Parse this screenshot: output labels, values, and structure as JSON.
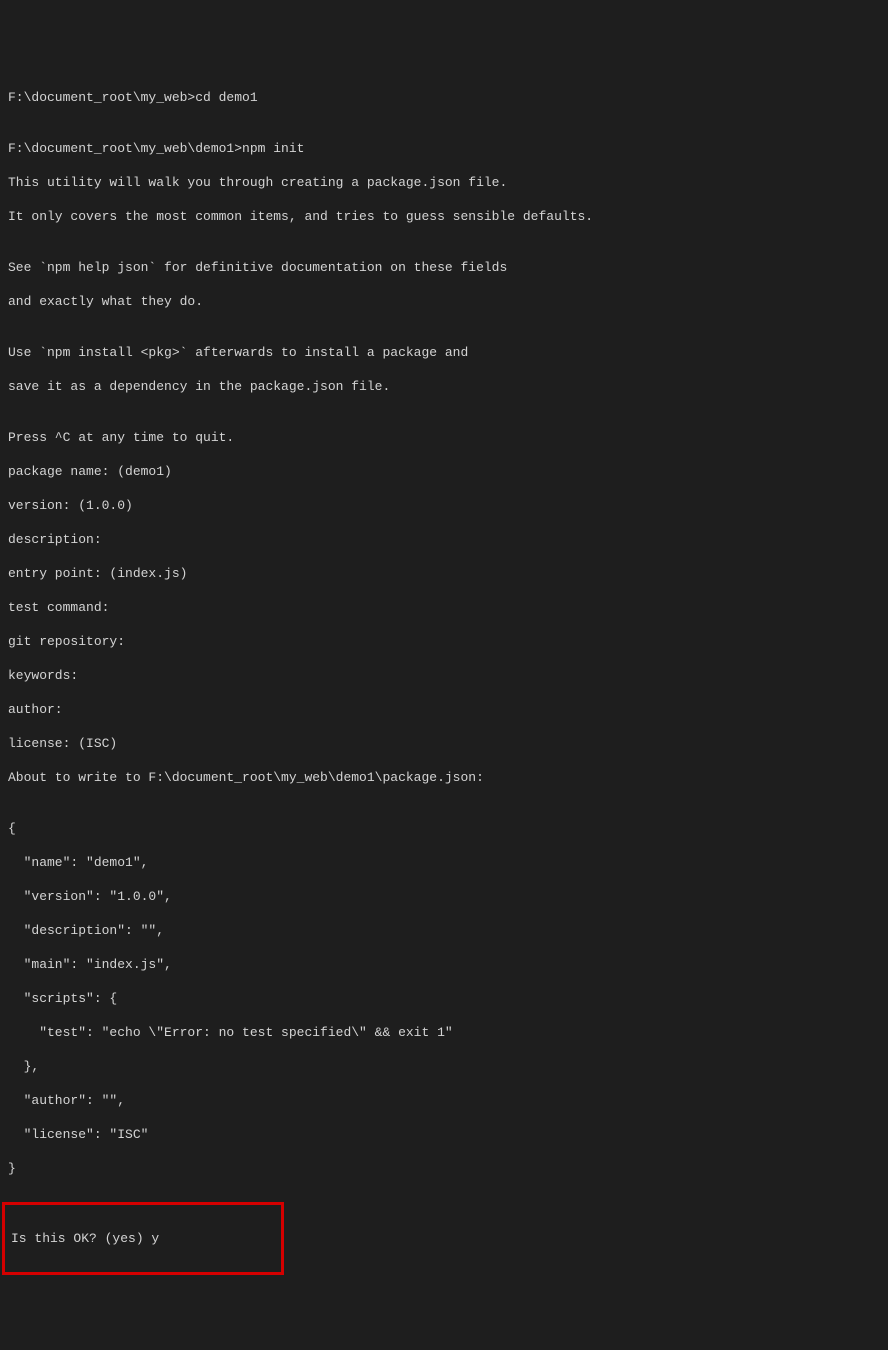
{
  "lines": {
    "l1": "F:\\document_root\\my_web>cd demo1",
    "l2": "",
    "l3": "F:\\document_root\\my_web\\demo1>npm init",
    "l4": "This utility will walk you through creating a package.json file.",
    "l5": "It only covers the most common items, and tries to guess sensible defaults.",
    "l6": "",
    "l7": "See `npm help json` for definitive documentation on these fields",
    "l8": "and exactly what they do.",
    "l9": "",
    "l10": "Use `npm install <pkg>` afterwards to install a package and",
    "l11": "save it as a dependency in the package.json file.",
    "l12": "",
    "l13": "Press ^C at any time to quit.",
    "l14": "package name: (demo1)",
    "l15": "version: (1.0.0)",
    "l16": "description:",
    "l17": "entry point: (index.js)",
    "l18": "test command:",
    "l19": "git repository:",
    "l20": "keywords:",
    "l21": "author:",
    "l22": "license: (ISC)",
    "l23": "About to write to F:\\document_root\\my_web\\demo1\\package.json:",
    "l24": "",
    "l25": "{",
    "l26": "  \"name\": \"demo1\",",
    "l27": "  \"version\": \"1.0.0\",",
    "l28": "  \"description\": \"\",",
    "l29": "  \"main\": \"index.js\",",
    "l30": "  \"scripts\": {",
    "l31": "    \"test\": \"echo \\\"Error: no test specified\\\" && exit 1\"",
    "l32": "  },",
    "l33": "  \"author\": \"\",",
    "l34": "  \"license\": \"ISC\"",
    "l35": "}",
    "l36": "",
    "confirm": "Is this OK? (yes) y"
  }
}
